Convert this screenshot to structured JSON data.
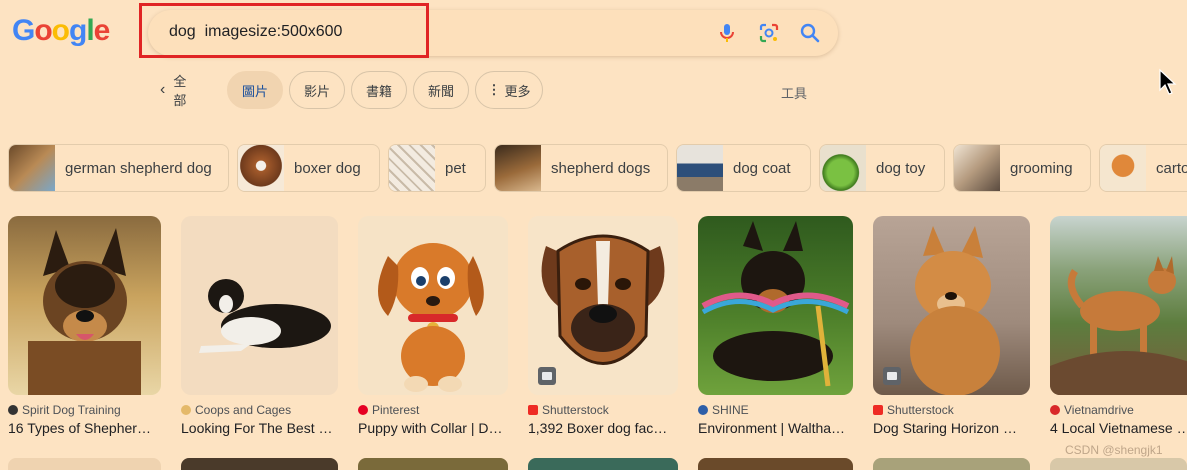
{
  "logo": {
    "letters": [
      "G",
      "o",
      "o",
      "g",
      "l",
      "e"
    ],
    "colors": [
      "#4285f4",
      "#ea4335",
      "#fbbc05",
      "#4285f4",
      "#34a853",
      "#ea4335"
    ]
  },
  "search": {
    "query": "dog  imagesize:500x600"
  },
  "icons": {
    "mic": "microphone-icon",
    "lens": "google-lens-icon",
    "search": "search-icon"
  },
  "tabs": {
    "all": "全部",
    "items": [
      "圖片",
      "影片",
      "書籍",
      "新聞",
      "更多"
    ],
    "tools": "工具"
  },
  "chips": [
    "german shepherd dog",
    "boxer dog",
    "pet",
    "shepherd dogs",
    "dog coat",
    "dog toy",
    "grooming",
    "carto"
  ],
  "results": [
    {
      "source": "Spirit Dog Training",
      "title": "16 Types of Shepher…"
    },
    {
      "source": "Coops and Cages",
      "title": "Looking For The Best …"
    },
    {
      "source": "Pinterest",
      "title": "Puppy with Collar | D…"
    },
    {
      "source": "Shutterstock",
      "title": "1,392 Boxer dog fac…"
    },
    {
      "source": "SHINE",
      "title": "Environment | Waltha…"
    },
    {
      "source": "Shutterstock",
      "title": "Dog Staring Horizon …"
    },
    {
      "source": "Vietnamdrive",
      "title": "4 Local Vietnamese …"
    }
  ],
  "watermark": "CSDN @shengjk1",
  "colors": {
    "background": "#fde3c2",
    "highlight": "#e02424",
    "active_tab_text": "#1a4f9c"
  }
}
